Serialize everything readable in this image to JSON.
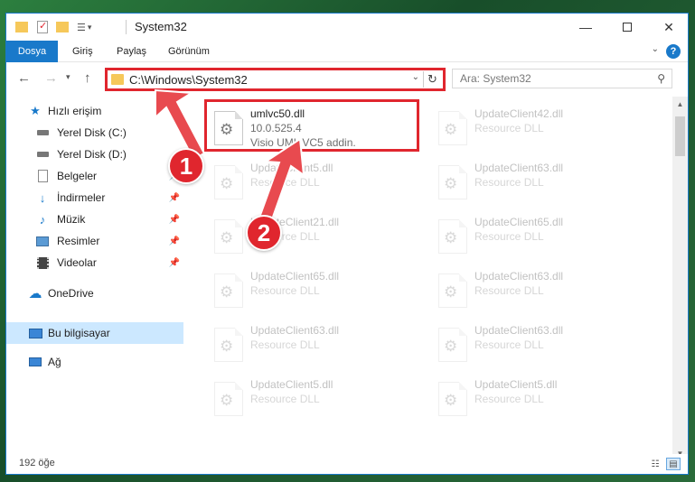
{
  "window": {
    "title": "System32"
  },
  "ribbon": {
    "tabs": [
      "Dosya",
      "Giriş",
      "Paylaş",
      "Görünüm"
    ]
  },
  "nav": {
    "address": "C:\\Windows\\System32",
    "search_placeholder": "Ara: System32"
  },
  "sidebar": {
    "items": [
      {
        "label": "Hızlı erişim",
        "icon": "star-icon"
      },
      {
        "label": "Yerel Disk (C:)",
        "icon": "drive-icon"
      },
      {
        "label": "Yerel Disk (D:)",
        "icon": "drive-icon"
      },
      {
        "label": "Belgeler",
        "icon": "documents-icon"
      },
      {
        "label": "İndirmeler",
        "icon": "download-icon"
      },
      {
        "label": "Müzik",
        "icon": "music-icon"
      },
      {
        "label": "Resimler",
        "icon": "pictures-icon"
      },
      {
        "label": "Videolar",
        "icon": "video-icon"
      },
      {
        "label": "OneDrive",
        "icon": "cloud-icon"
      },
      {
        "label": "Bu bilgisayar",
        "icon": "computer-icon"
      },
      {
        "label": "Ağ",
        "icon": "network-icon"
      }
    ]
  },
  "files": [
    {
      "name": "umlvc50.dll",
      "line2": "10.0.525.4",
      "line3": "Visio UML VC5 addin."
    },
    {
      "name": "UpdateClient42.dll",
      "line2": "Resource DLL"
    },
    {
      "name": "UpdateClient5.dll",
      "line2": "Resource DLL"
    },
    {
      "name": "UpdateClient63.dll",
      "line2": "Resource DLL"
    },
    {
      "name": "UpdateClient21.dll",
      "line2": "Resource DLL"
    },
    {
      "name": "UpdateClient65.dll",
      "line2": "Resource DLL"
    },
    {
      "name": "UpdateClient65.dll",
      "line2": "Resource DLL"
    },
    {
      "name": "UpdateClient63.dll",
      "line2": "Resource DLL"
    },
    {
      "name": "UpdateClient63.dll",
      "line2": "Resource DLL"
    },
    {
      "name": "UpdateClient63.dll",
      "line2": "Resource DLL"
    },
    {
      "name": "UpdateClient5.dll",
      "line2": "Resource DLL"
    },
    {
      "name": "UpdateClient5.dll",
      "line2": "Resource DLL"
    }
  ],
  "status": {
    "count": "192 öğe"
  },
  "annotations": {
    "step1": "1",
    "step2": "2"
  },
  "colors": {
    "accent": "#1979ca",
    "highlight": "#e0262e",
    "selected": "#cce8ff"
  }
}
